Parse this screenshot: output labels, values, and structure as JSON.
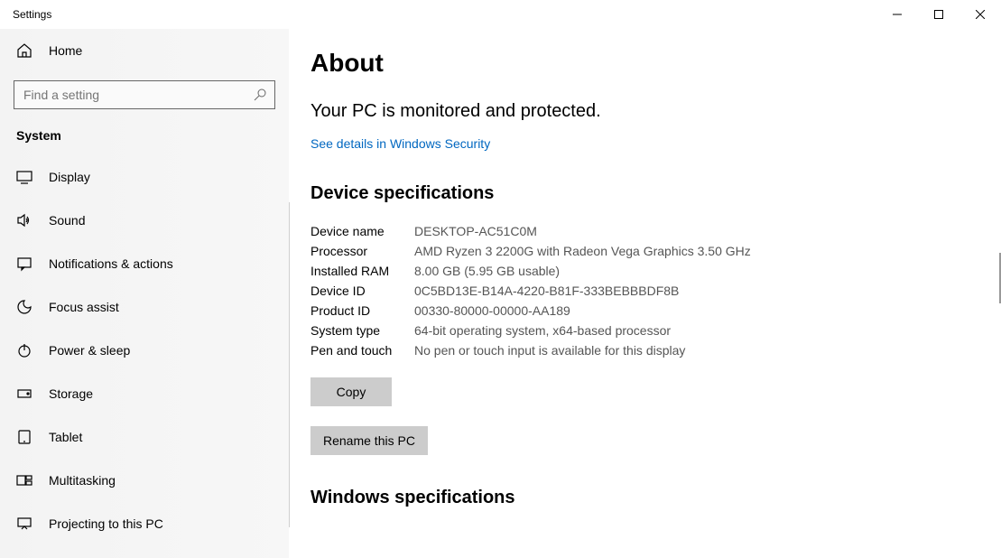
{
  "window": {
    "title": "Settings"
  },
  "sidebar": {
    "home_label": "Home",
    "search_placeholder": "Find a setting",
    "category": "System",
    "items": [
      {
        "label": "Display"
      },
      {
        "label": "Sound"
      },
      {
        "label": "Notifications & actions"
      },
      {
        "label": "Focus assist"
      },
      {
        "label": "Power & sleep"
      },
      {
        "label": "Storage"
      },
      {
        "label": "Tablet"
      },
      {
        "label": "Multitasking"
      },
      {
        "label": "Projecting to this PC"
      }
    ]
  },
  "main": {
    "title": "About",
    "protection_text": "Your PC is monitored and protected.",
    "security_link": "See details in Windows Security",
    "device_spec_heading": "Device specifications",
    "specs": {
      "device_name_label": "Device name",
      "device_name_value": "DESKTOP-AC51C0M",
      "processor_label": "Processor",
      "processor_value": "AMD Ryzen 3 2200G with Radeon Vega Graphics     3.50 GHz",
      "ram_label": "Installed RAM",
      "ram_value": "8.00 GB (5.95 GB usable)",
      "device_id_label": "Device ID",
      "device_id_value": "0C5BD13E-B14A-4220-B81F-333BEBBBDF8B",
      "product_id_label": "Product ID",
      "product_id_value": "00330-80000-00000-AA189",
      "system_type_label": "System type",
      "system_type_value": "64-bit operating system, x64-based processor",
      "pen_touch_label": "Pen and touch",
      "pen_touch_value": "No pen or touch input is available for this display"
    },
    "copy_button": "Copy",
    "rename_button": "Rename this PC",
    "windows_spec_heading": "Windows specifications"
  }
}
